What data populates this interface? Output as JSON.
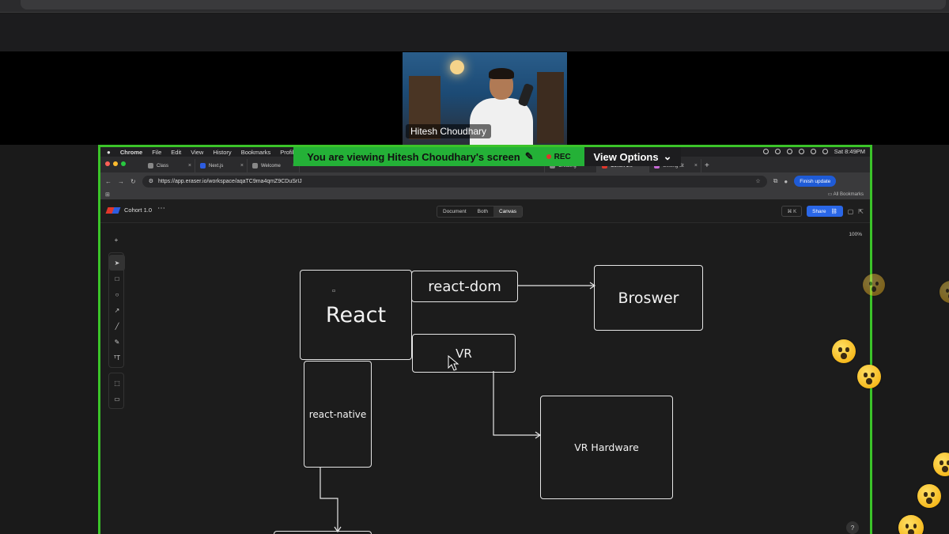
{
  "presenter": {
    "name": "Hitesh Choudhary"
  },
  "banner": {
    "text": "You are viewing  Hitesh Choudhary's screen",
    "rec_label": "REC",
    "view_options_label": "View Options"
  },
  "mac_menubar": {
    "app": "Chrome",
    "items": [
      "File",
      "Edit",
      "View",
      "History",
      "Bookmarks",
      "Profiles"
    ],
    "clock": "Sat 8:49PM"
  },
  "browser": {
    "tabs": [
      {
        "label": "Class"
      },
      {
        "label": "Next.js"
      },
      {
        "label": "Welcome"
      },
      {
        "label": "Creating"
      },
      {
        "label": "Cohort 1.0"
      },
      {
        "label": "Getting St"
      }
    ],
    "url": "https://app.eraser.io/workspace/aqaTC9ma4qmZ9CDuSrIJ",
    "finish_update_label": "Finish update",
    "all_bookmarks_label": "All Bookmarks"
  },
  "app": {
    "title": "Cohort 1.0",
    "modes": [
      "Document",
      "Both",
      "Canvas"
    ],
    "selected_mode": "Canvas",
    "shortcut": "⌘ K",
    "share_label": "Share",
    "zoom": "100%",
    "help": "?"
  },
  "diagram": {
    "nodes": {
      "react": "React",
      "react_dom": "react-dom",
      "browser": "Broswer",
      "vr": "VR",
      "react_native": "react-native",
      "vr_hardware": "VR Hardware"
    }
  },
  "colors": {
    "share_border": "#3bc429",
    "banner_green": "#24b137",
    "share_button": "#2a67e8"
  }
}
